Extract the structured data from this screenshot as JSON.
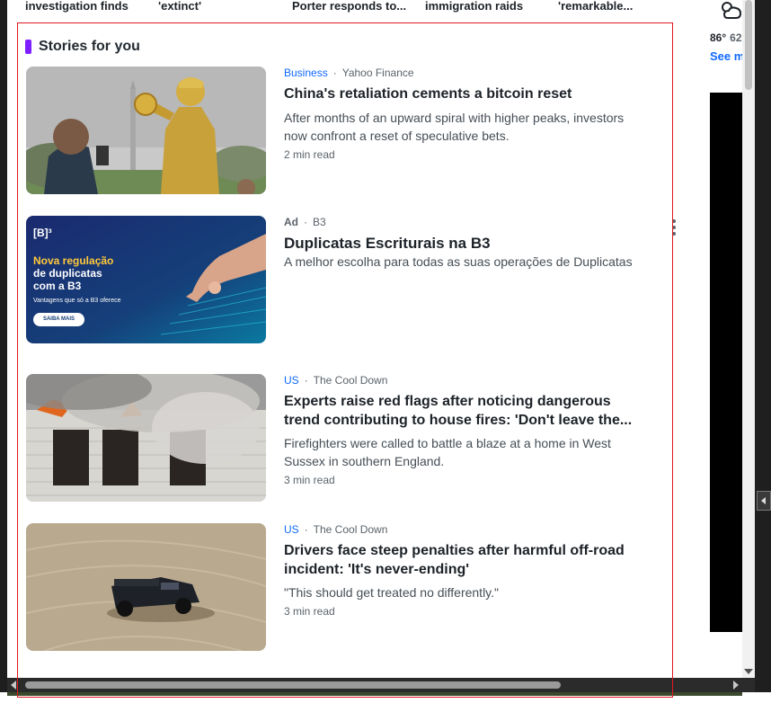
{
  "trending": [
    {
      "label": "investigation finds"
    },
    {
      "label": "'extinct'"
    },
    {
      "label": "Porter responds to..."
    },
    {
      "label": "immigration raids"
    },
    {
      "label": "'remarkable..."
    }
  ],
  "weather": {
    "high": "86°",
    "low": "62",
    "see_more": "See m"
  },
  "section": {
    "title": "Stories for you"
  },
  "stories": [
    {
      "category": "Business",
      "source": "Yahoo Finance",
      "headline": "China's retaliation cements a bitcoin reset",
      "summary": "After months of an upward spiral with higher peaks, investors now confront a reset of speculative bets.",
      "read_time": "2 min read",
      "thumb": "golden-statue-holding-bitcoin"
    },
    {
      "category": "Ad",
      "source": "B3",
      "headline": "Duplicatas Escriturais na B3",
      "summary": "A melhor escolha para todas as suas operações de Duplicatas",
      "thumb": "b3-ad-banner",
      "ad_banner": {
        "logo": "[B]³",
        "line1": "Nova regulação",
        "line2": "de duplicatas",
        "line3": "com a B3",
        "tagline": "Vantagens que só a B3 oferece",
        "cta": "SAIBA MAIS"
      }
    },
    {
      "category": "US",
      "source": "The Cool Down",
      "headline": "Experts raise red flags after noticing dangerous trend contributing to house fires: 'Don't leave the...",
      "summary": "Firefighters were called to battle a blaze at a home in West Sussex in southern England.",
      "read_time": "3 min read",
      "thumb": "burning-house"
    },
    {
      "category": "US",
      "source": "The Cool Down",
      "headline": "Drivers face steep penalties after harmful off-road incident: 'It's never-ending'",
      "summary": "\"This should get treated no differently.\"",
      "read_time": "3 min read",
      "thumb": "truck-on-sand"
    }
  ],
  "colors": {
    "accent": "#7e1fff",
    "link": "#0f69ff",
    "outline": "#e0181e"
  }
}
